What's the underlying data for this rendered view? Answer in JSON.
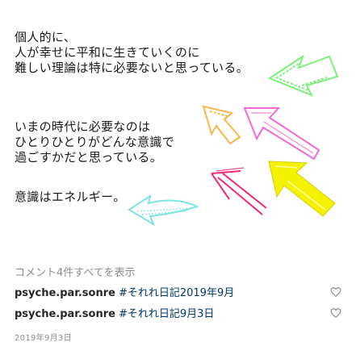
{
  "post": {
    "paragraphs": [
      [
        "個人的に、",
        "人が幸せに平和に生きていくのに",
        "難しい理論は特に必要ないと思っている。"
      ],
      [
        "いまの時代に必要なのは",
        "ひとりひとりがどんな意識で",
        "過ごすかだと思っている。"
      ],
      [
        "意識はエネルギー。"
      ]
    ]
  },
  "comments_link": "コメント4件すべてを表示",
  "comments": [
    {
      "username": "psyche.par.sonre",
      "text": "#それれ日記2019年9月"
    },
    {
      "username": "psyche.par.sonre",
      "text": "#それれ日記9月3日"
    }
  ],
  "post_date": "2019年9月3日",
  "colors": {
    "green": "#7cf07a",
    "orange": "#f5b84a",
    "pink": "#f26ad8",
    "magenta": "#f0287a",
    "yellow": "#f5f200",
    "cyan": "#7fe3df",
    "hashtag": "#00376b",
    "meta": "#8e8e8e"
  }
}
